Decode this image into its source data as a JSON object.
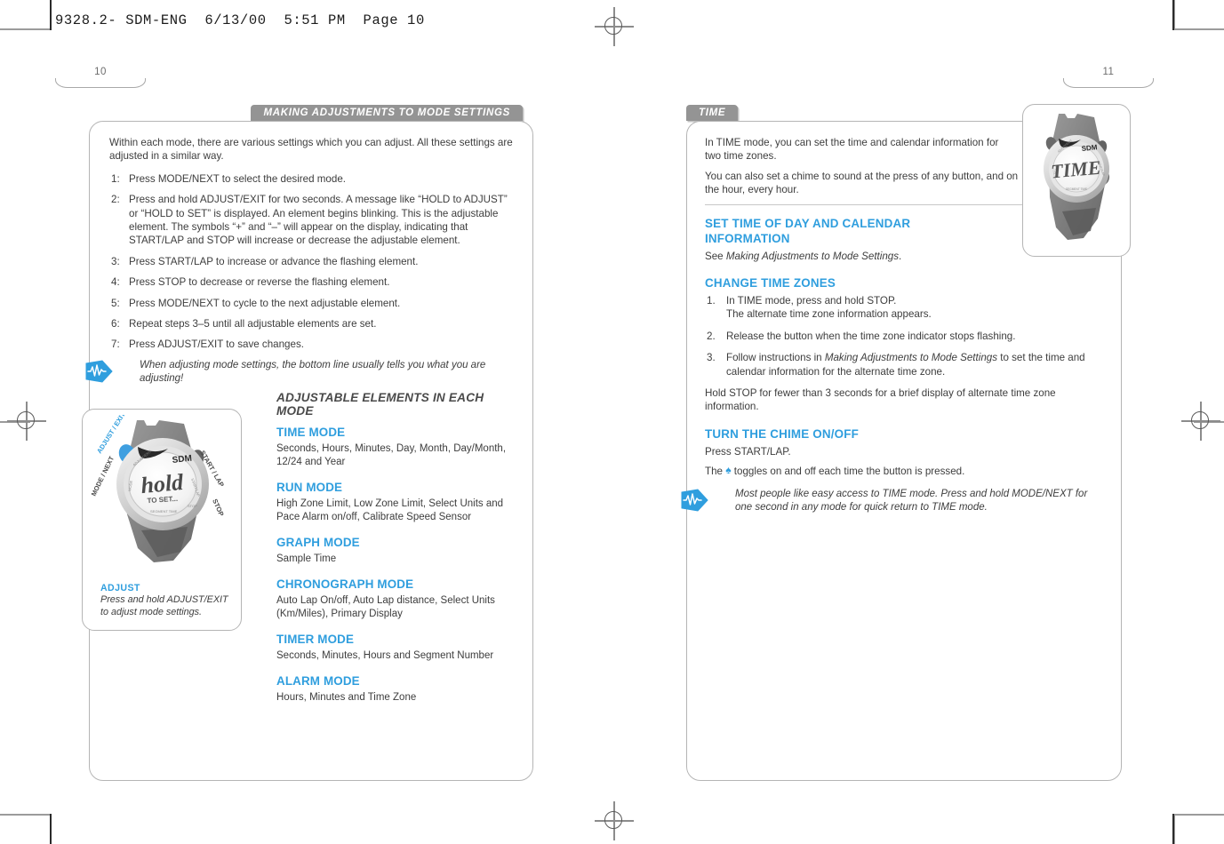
{
  "sheet": {
    "slug_line": "9328.2- SDM-ENG  6/13/00  5:51 PM  Page 10"
  },
  "folios": {
    "left": "10",
    "right": "11"
  },
  "colors": {
    "accent_blue": "#2f9ede",
    "tab_gray": "#949494",
    "body_text": "#3d3d3d",
    "rule_gray": "#b5b5b5"
  },
  "left_page": {
    "section_tab": "MAKING ADJUSTMENTS TO MODE SETTINGS",
    "intro": "Within each mode, there are various settings which you can adjust. All these settings are adjusted in a similar way.",
    "steps": [
      {
        "marker": "1:",
        "text": "Press MODE/NEXT to select the desired mode."
      },
      {
        "marker": "2:",
        "text": "Press and hold ADJUST/EXIT for two seconds. A message like “HOLD to ADJUST” or “HOLD to SET” is displayed. An element begins blinking. This is the adjustable element. The symbols “+” and “–” will appear on the display, indicating that START/LAP and STOP will increase or decrease the adjustable element."
      },
      {
        "marker": "3:",
        "text": "Press START/LAP to increase or advance the flashing element."
      },
      {
        "marker": "4:",
        "text": "Press STOP to decrease or reverse the flashing element."
      },
      {
        "marker": "5:",
        "text": "Press MODE/NEXT to cycle to the next adjustable element."
      },
      {
        "marker": "6:",
        "text": "Repeat steps 3–5 until all adjustable elements are set."
      },
      {
        "marker": "7:",
        "text": "Press ADJUST/EXIT to save changes."
      }
    ],
    "tip": "When adjusting mode settings, the bottom line usually tells you what you are adjusting!",
    "figure": {
      "watch_display_main": "hold",
      "watch_display_sub": "TO SET...",
      "watch_brand": "SDM",
      "button_labels": {
        "top_left": "ADJUST / EXIT",
        "bottom_left": "MODE / NEXT",
        "top_right": "START / LAP",
        "bottom_right": "STOP"
      },
      "caption_title": "ADJUST",
      "caption_text": "Press and hold ADJUST/EXIT to adjust mode settings."
    },
    "elements_heading": "ADJUSTABLE ELEMENTS IN EACH MODE",
    "modes": [
      {
        "name": "TIME MODE",
        "elements": "Seconds, Hours, Minutes, Day, Month, Day/Month, 12/24 and Year"
      },
      {
        "name": "RUN MODE",
        "elements": "High Zone Limit, Low Zone Limit, Select Units and Pace Alarm on/off, Calibrate Speed Sensor"
      },
      {
        "name": "GRAPH MODE",
        "elements": "Sample Time"
      },
      {
        "name": "CHRONOGRAPH MODE",
        "elements": "Auto Lap On/off, Auto Lap distance, Select Units (Km/Miles), Primary Display"
      },
      {
        "name": "TIMER MODE",
        "elements": "Seconds, Minutes, Hours and Segment Number"
      },
      {
        "name": "ALARM MODE",
        "elements": "Hours, Minutes and Time Zone"
      }
    ]
  },
  "right_page": {
    "section_tab": "TIME",
    "intro_paragraphs": [
      "In TIME mode, you can set the time and calendar information for two time zones.",
      "You can also set a chime to sound at the press of any button, and on the hour, every hour."
    ],
    "figure": {
      "watch_display_main": "TIME",
      "watch_brand": "SDM"
    },
    "sections": [
      {
        "heading": "SET TIME OF DAY AND CALENDAR INFORMATION",
        "see_prefix": "See ",
        "see_italic": "Making Adjustments to Mode Settings",
        "see_suffix": "."
      },
      {
        "heading": "CHANGE TIME ZONES",
        "steps": [
          {
            "marker": "1.",
            "line1": "In TIME mode, press and hold STOP.",
            "line2": "The alternate time zone information appears."
          },
          {
            "marker": "2.",
            "line1": "Release the button when the time zone indicator stops flashing.",
            "line2": ""
          },
          {
            "marker": "3.",
            "pre": "Follow instructions in ",
            "italic": "Making Adjustments to Mode Settings",
            "post": " to set the time and calendar information for the alternate time zone."
          }
        ],
        "after": "Hold STOP for fewer than 3 seconds for a brief display of alternate time zone information."
      },
      {
        "heading": "TURN THE CHIME ON/OFF",
        "line1": "Press START/LAP.",
        "line2_pre": "The ",
        "line2_glyph": "♠",
        "line2_post": " toggles on and off each time the button is pressed."
      }
    ],
    "tip": "Most people like easy access to TIME mode. Press and hold MODE/NEXT for one second in any mode for quick return to TIME mode."
  }
}
